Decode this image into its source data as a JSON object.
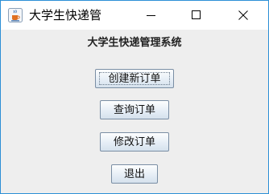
{
  "window": {
    "title": "大学生快递管",
    "icon": "java-cup-icon",
    "controls": [
      "minimize-icon",
      "maximize-icon",
      "close-icon"
    ]
  },
  "main": {
    "heading": "大学生快递管理系统",
    "buttons": {
      "create": "创建新订单",
      "query": "查询订单",
      "modify": "修改订单",
      "exit": "退出"
    }
  },
  "colors": {
    "window_border": "#2b8fd6",
    "background": "#eeeeee",
    "button_border": "#7a8ea4"
  }
}
